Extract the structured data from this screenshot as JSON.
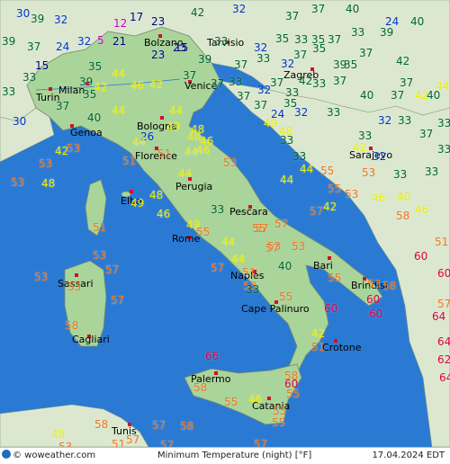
{
  "map": {
    "colors": {
      "sea": "#2a7ad4",
      "land": "#a9d49a",
      "land_north": "#dbe8cf",
      "border": "#7a8a6a"
    },
    "legend": {
      "title": "Minimum Temperature (night) [°F]",
      "source": "© woweather.com",
      "date": "17.04.2024 EDT"
    },
    "cities": [
      "Bolzano",
      "Tarvisio",
      "Milan",
      "Venice",
      "Zagreb",
      "Turin",
      "Bologna",
      "Genoa",
      "Florence",
      "Sarajevo",
      "Elba",
      "Perugia",
      "Pescara",
      "Rome",
      "Bari",
      "Naples",
      "Brindisi",
      "Sassari",
      "Cape Palinuro",
      "Cagliari",
      "Crotone",
      "Palermo",
      "Catania",
      "Tunis"
    ],
    "temps": [
      {
        "v": "30",
        "c": "#0033cc"
      },
      {
        "v": "39",
        "c": "#006633"
      },
      {
        "v": "32",
        "c": "#0033cc"
      },
      {
        "v": "12",
        "c": "#cc00cc"
      },
      {
        "v": "17",
        "c": "#000088"
      },
      {
        "v": "23",
        "c": "#000088"
      },
      {
        "v": "42",
        "c": "#006633"
      },
      {
        "v": "23",
        "c": "#000088"
      },
      {
        "v": "32",
        "c": "#0033cc"
      },
      {
        "v": "37",
        "c": "#006633"
      },
      {
        "v": "37",
        "c": "#006633"
      },
      {
        "v": "40",
        "c": "#006633"
      },
      {
        "v": "24",
        "c": "#0033cc"
      },
      {
        "v": "39",
        "c": "#006633"
      },
      {
        "v": "37",
        "c": "#006633"
      },
      {
        "v": "24",
        "c": "#0033cc"
      },
      {
        "v": "32",
        "c": "#0033cc"
      },
      {
        "v": "5",
        "c": "#cc00cc"
      },
      {
        "v": "21",
        "c": "#000088"
      },
      {
        "v": "23",
        "c": "#000088"
      },
      {
        "v": "15",
        "c": "#000088"
      },
      {
        "v": "33",
        "c": "#006633"
      },
      {
        "v": "32",
        "c": "#0033cc"
      },
      {
        "v": "35",
        "c": "#006633"
      },
      {
        "v": "33",
        "c": "#006633"
      },
      {
        "v": "35",
        "c": "#006633"
      },
      {
        "v": "37",
        "c": "#006633"
      },
      {
        "v": "33",
        "c": "#006633"
      },
      {
        "v": "39",
        "c": "#006633"
      },
      {
        "v": "40",
        "c": "#006633"
      },
      {
        "v": "15",
        "c": "#000088"
      },
      {
        "v": "35",
        "c": "#006633"
      },
      {
        "v": "39",
        "c": "#006633"
      },
      {
        "v": "37",
        "c": "#006633"
      },
      {
        "v": "32",
        "c": "#0033cc"
      },
      {
        "v": "33",
        "c": "#006633"
      },
      {
        "v": "37",
        "c": "#006633"
      },
      {
        "v": "35",
        "c": "#006633"
      },
      {
        "v": "39",
        "c": "#006633"
      },
      {
        "v": "37",
        "c": "#006633"
      },
      {
        "v": "42",
        "c": "#006633"
      },
      {
        "v": "33",
        "c": "#006633"
      },
      {
        "v": "39",
        "c": "#006633"
      },
      {
        "v": "44",
        "c": "#eeee00"
      },
      {
        "v": "42",
        "c": "#eeee00"
      },
      {
        "v": "46",
        "c": "#eeee00"
      },
      {
        "v": "42",
        "c": "#eeee00"
      },
      {
        "v": "37",
        "c": "#006633"
      },
      {
        "v": "37",
        "c": "#006633"
      },
      {
        "v": "33",
        "c": "#006633"
      },
      {
        "v": "32",
        "c": "#0033cc"
      },
      {
        "v": "33",
        "c": "#006633"
      },
      {
        "v": "33",
        "c": "#006633"
      },
      {
        "v": "37",
        "c": "#006633"
      },
      {
        "v": "40",
        "c": "#006633"
      },
      {
        "v": "37",
        "c": "#006633"
      },
      {
        "v": "40",
        "c": "#006633"
      },
      {
        "v": "33",
        "c": "#006633"
      },
      {
        "v": "37",
        "c": "#006633"
      },
      {
        "v": "35",
        "c": "#006633"
      },
      {
        "v": "37",
        "c": "#006633"
      },
      {
        "v": "37",
        "c": "#006633"
      },
      {
        "v": "42",
        "c": "#006633"
      },
      {
        "v": "35",
        "c": "#006633"
      },
      {
        "v": "37",
        "c": "#006633"
      },
      {
        "v": "42",
        "c": "#eeee00"
      },
      {
        "v": "44",
        "c": "#eeee00"
      },
      {
        "v": "37",
        "c": "#006633"
      },
      {
        "v": "24",
        "c": "#0033cc"
      },
      {
        "v": "35",
        "c": "#006633"
      },
      {
        "v": "33",
        "c": "#006633"
      },
      {
        "v": "32",
        "c": "#0033cc"
      },
      {
        "v": "32",
        "c": "#0033cc"
      },
      {
        "v": "33",
        "c": "#006633"
      },
      {
        "v": "30",
        "c": "#0033cc"
      },
      {
        "v": "40",
        "c": "#006633"
      },
      {
        "v": "44",
        "c": "#eeee00"
      },
      {
        "v": "49",
        "c": "#eeee00"
      },
      {
        "v": "48",
        "c": "#eeee00"
      },
      {
        "v": "26",
        "c": "#0033cc"
      },
      {
        "v": "48",
        "c": "#eeee00"
      },
      {
        "v": "46",
        "c": "#eeee00"
      },
      {
        "v": "44",
        "c": "#eeee00"
      },
      {
        "v": "37",
        "c": "#006633"
      },
      {
        "v": "33",
        "c": "#006633"
      },
      {
        "v": "33",
        "c": "#006633"
      },
      {
        "v": "33",
        "c": "#006633"
      },
      {
        "v": "48",
        "c": "#eeee00"
      },
      {
        "v": "53",
        "c": "#ee7722"
      },
      {
        "v": "44",
        "c": "#eeee00"
      },
      {
        "v": "51",
        "c": "#ee7722"
      },
      {
        "v": "53",
        "c": "#ee7722"
      },
      {
        "v": "33",
        "c": "#006633"
      },
      {
        "v": "33",
        "c": "#006633"
      },
      {
        "v": "42",
        "c": "#eeee00"
      },
      {
        "v": "32",
        "c": "#0033cc"
      },
      {
        "v": "33",
        "c": "#006633"
      },
      {
        "v": "42",
        "c": "#eeee00"
      },
      {
        "v": "49",
        "c": "#eeee00"
      },
      {
        "v": "53",
        "c": "#ee7722"
      },
      {
        "v": "44",
        "c": "#eeee00"
      },
      {
        "v": "51",
        "c": "#ee7722"
      },
      {
        "v": "44",
        "c": "#eeee00"
      },
      {
        "v": "44",
        "c": "#eeee00"
      },
      {
        "v": "53",
        "c": "#ee7722"
      },
      {
        "v": "46",
        "c": "#eeee00"
      },
      {
        "v": "33",
        "c": "#006633"
      },
      {
        "v": "53",
        "c": "#ee7722"
      },
      {
        "v": "48",
        "c": "#eeee00"
      },
      {
        "v": "55",
        "c": "#ee7722"
      },
      {
        "v": "48",
        "c": "#eeee00"
      },
      {
        "v": "49",
        "c": "#eeee00"
      },
      {
        "v": "44",
        "c": "#eeee00"
      },
      {
        "v": "55",
        "c": "#ee7722"
      },
      {
        "v": "53",
        "c": "#ee7722"
      },
      {
        "v": "46",
        "c": "#eeee00"
      },
      {
        "v": "40",
        "c": "#eeee00"
      },
      {
        "v": "58",
        "c": "#ee7722"
      },
      {
        "v": "46",
        "c": "#eeee00"
      },
      {
        "v": "46",
        "c": "#eeee00"
      },
      {
        "v": "33",
        "c": "#006633"
      },
      {
        "v": "57",
        "c": "#ee7722"
      },
      {
        "v": "49",
        "c": "#eeee00"
      },
      {
        "v": "55",
        "c": "#ee7722"
      },
      {
        "v": "44",
        "c": "#eeee00"
      },
      {
        "v": "53",
        "c": "#ee7722"
      },
      {
        "v": "44",
        "c": "#eeee00"
      },
      {
        "v": "57",
        "c": "#ee7722"
      },
      {
        "v": "42",
        "c": "#eeee00"
      },
      {
        "v": "57",
        "c": "#ee7722"
      },
      {
        "v": "53",
        "c": "#ee7722"
      },
      {
        "v": "51",
        "c": "#ee7722"
      },
      {
        "v": "60",
        "c": "#dd0044"
      },
      {
        "v": "51",
        "c": "#ee7722"
      },
      {
        "v": "53",
        "c": "#ee7722"
      },
      {
        "v": "53",
        "c": "#ee7722"
      },
      {
        "v": "57",
        "c": "#ee7722"
      },
      {
        "v": "40",
        "c": "#006633"
      },
      {
        "v": "53",
        "c": "#ee7722"
      },
      {
        "v": "55",
        "c": "#ee7722"
      },
      {
        "v": "55",
        "c": "#ee7722"
      },
      {
        "v": "57",
        "c": "#ee7722"
      },
      {
        "v": "60",
        "c": "#dd0044"
      },
      {
        "v": "51",
        "c": "#ee7722"
      },
      {
        "v": "53",
        "c": "#ee7722"
      },
      {
        "v": "57",
        "c": "#ee7722"
      },
      {
        "v": "33",
        "c": "#006633"
      },
      {
        "v": "53",
        "c": "#ee7722"
      },
      {
        "v": "58",
        "c": "#ee7722"
      },
      {
        "v": "60",
        "c": "#dd0044"
      },
      {
        "v": "60",
        "c": "#dd0044"
      },
      {
        "v": "57",
        "c": "#ee7722"
      },
      {
        "v": "64",
        "c": "#dd0044"
      },
      {
        "v": "55",
        "c": "#ee7722"
      },
      {
        "v": "57",
        "c": "#ee7722"
      },
      {
        "v": "60",
        "c": "#dd0044"
      },
      {
        "v": "42",
        "c": "#eeee00"
      },
      {
        "v": "51",
        "c": "#ee7722"
      },
      {
        "v": "64",
        "c": "#dd0044"
      },
      {
        "v": "58",
        "c": "#ee7722"
      },
      {
        "v": "66",
        "c": "#dd0044"
      },
      {
        "v": "62",
        "c": "#dd0044"
      },
      {
        "v": "58",
        "c": "#ee7722"
      },
      {
        "v": "60",
        "c": "#dd0044"
      },
      {
        "v": "64",
        "c": "#dd0044"
      },
      {
        "v": "58",
        "c": "#ee7722"
      },
      {
        "v": "55",
        "c": "#ee7722"
      },
      {
        "v": "55",
        "c": "#ee7722"
      },
      {
        "v": "55",
        "c": "#ee7722"
      },
      {
        "v": "46",
        "c": "#eeee00"
      },
      {
        "v": "55",
        "c": "#ee7722"
      },
      {
        "v": "57",
        "c": "#ee7722"
      },
      {
        "v": "48",
        "c": "#eeee00"
      },
      {
        "v": "58",
        "c": "#ee7722"
      },
      {
        "v": "53",
        "c": "#ee7722"
      },
      {
        "v": "57",
        "c": "#ee7722"
      },
      {
        "v": "57",
        "c": "#ee7722"
      },
      {
        "v": "58",
        "c": "#ee7722"
      },
      {
        "v": "57",
        "c": "#ee7722"
      },
      {
        "v": "51",
        "c": "#ee7722"
      }
    ]
  }
}
